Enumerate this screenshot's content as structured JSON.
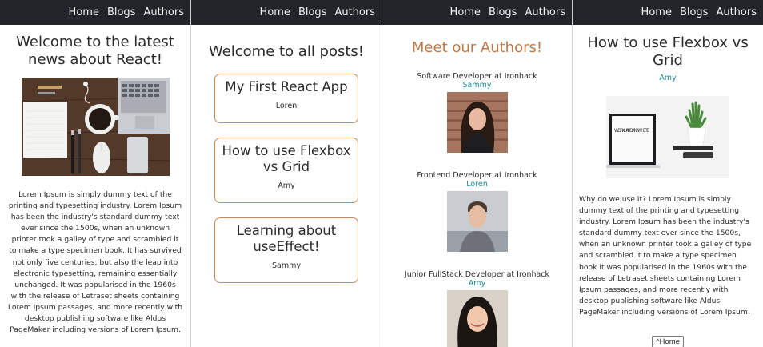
{
  "nav": {
    "home": "Home",
    "blogs": "Blogs",
    "authors": "Authors"
  },
  "home_view": {
    "title": "Welcome to the latest news about React!",
    "text": "Lorem Ipsum is simply dummy text of the printing and typesetting industry. Lorem Ipsum has been the industry's standard dummy text ever since the 1500s, when an unknown printer took a galley of type and scrambled it to make a type specimen book. It has survived not only five centuries, but also the leap into electronic typesetting, remaining essentially unchanged. It was popularised in the 1960s with the release of Letraset sheets containing Lorem Ipsum passages, and more recently with desktop publishing software like Aldus PageMaker including versions of Lorem Ipsum."
  },
  "blogs_view": {
    "title": "Welcome to all posts!",
    "posts": [
      {
        "title": "My First React App",
        "author": "Loren"
      },
      {
        "title": "How to use Flexbox vs Grid",
        "author": "Amy"
      },
      {
        "title": "Learning about useEffect!",
        "author": "Sammy"
      }
    ]
  },
  "authors_view": {
    "title": "Meet our Authors!",
    "authors": [
      {
        "role": "Software Developer at Ironhack",
        "name": "Sammy"
      },
      {
        "role": "Frontend Developer at Ironhack",
        "name": "Loren"
      },
      {
        "role": "Junior FullStack Developer at Ironhack",
        "name": "Amy"
      }
    ]
  },
  "post_view": {
    "title": "How to use Flexbox vs Grid",
    "author": "Amy",
    "image_caption": "WORKHARD ANYWHERE",
    "text": "Why do we use it? Lorem Ipsum is simply dummy text of the printing and typesetting industry. Lorem Ipsum has been the industry's standard dummy text ever since the 1500s, when an unknown printer took a galley of type and scrambled it to make a type specimen book It was popularised in the 1960s with the release of Letraset sheets containing Lorem Ipsum passages, and more recently with desktop publishing software like Aldus PageMaker including versions of Lorem Ipsum.",
    "home_button": "^Home"
  },
  "colors": {
    "accent": "#c98a5c",
    "link": "#1b8a9a",
    "navbar": "#212529"
  }
}
